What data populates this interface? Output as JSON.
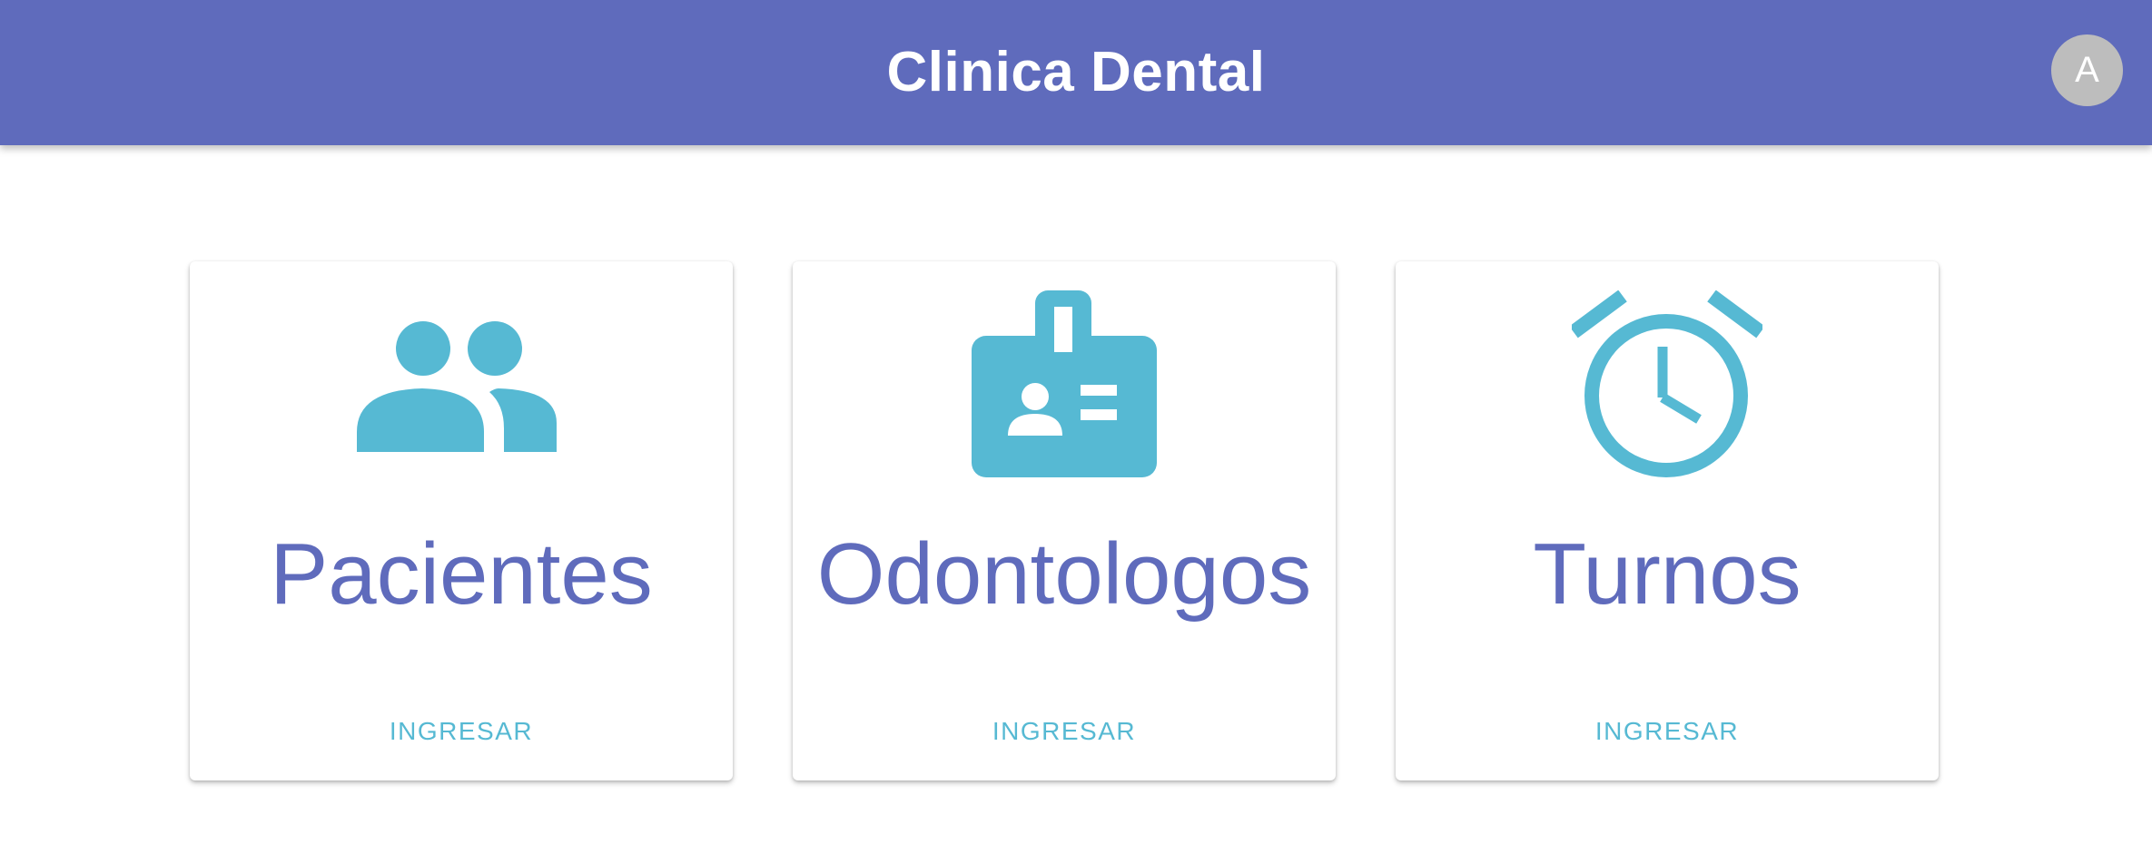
{
  "appbar": {
    "title": "Clinica Dental",
    "avatar_initial": "A",
    "background_color": "#5f6bbc"
  },
  "cards": [
    {
      "title": "Pacientes",
      "action_label": "INGRESAR",
      "icon": "people-icon"
    },
    {
      "title": "Odontologos",
      "action_label": "INGRESAR",
      "icon": "badge-icon"
    },
    {
      "title": "Turnos",
      "action_label": "INGRESAR",
      "icon": "alarm-clock-icon"
    }
  ],
  "colors": {
    "primary": "#5f6bbc",
    "accent": "#56b9d3"
  }
}
